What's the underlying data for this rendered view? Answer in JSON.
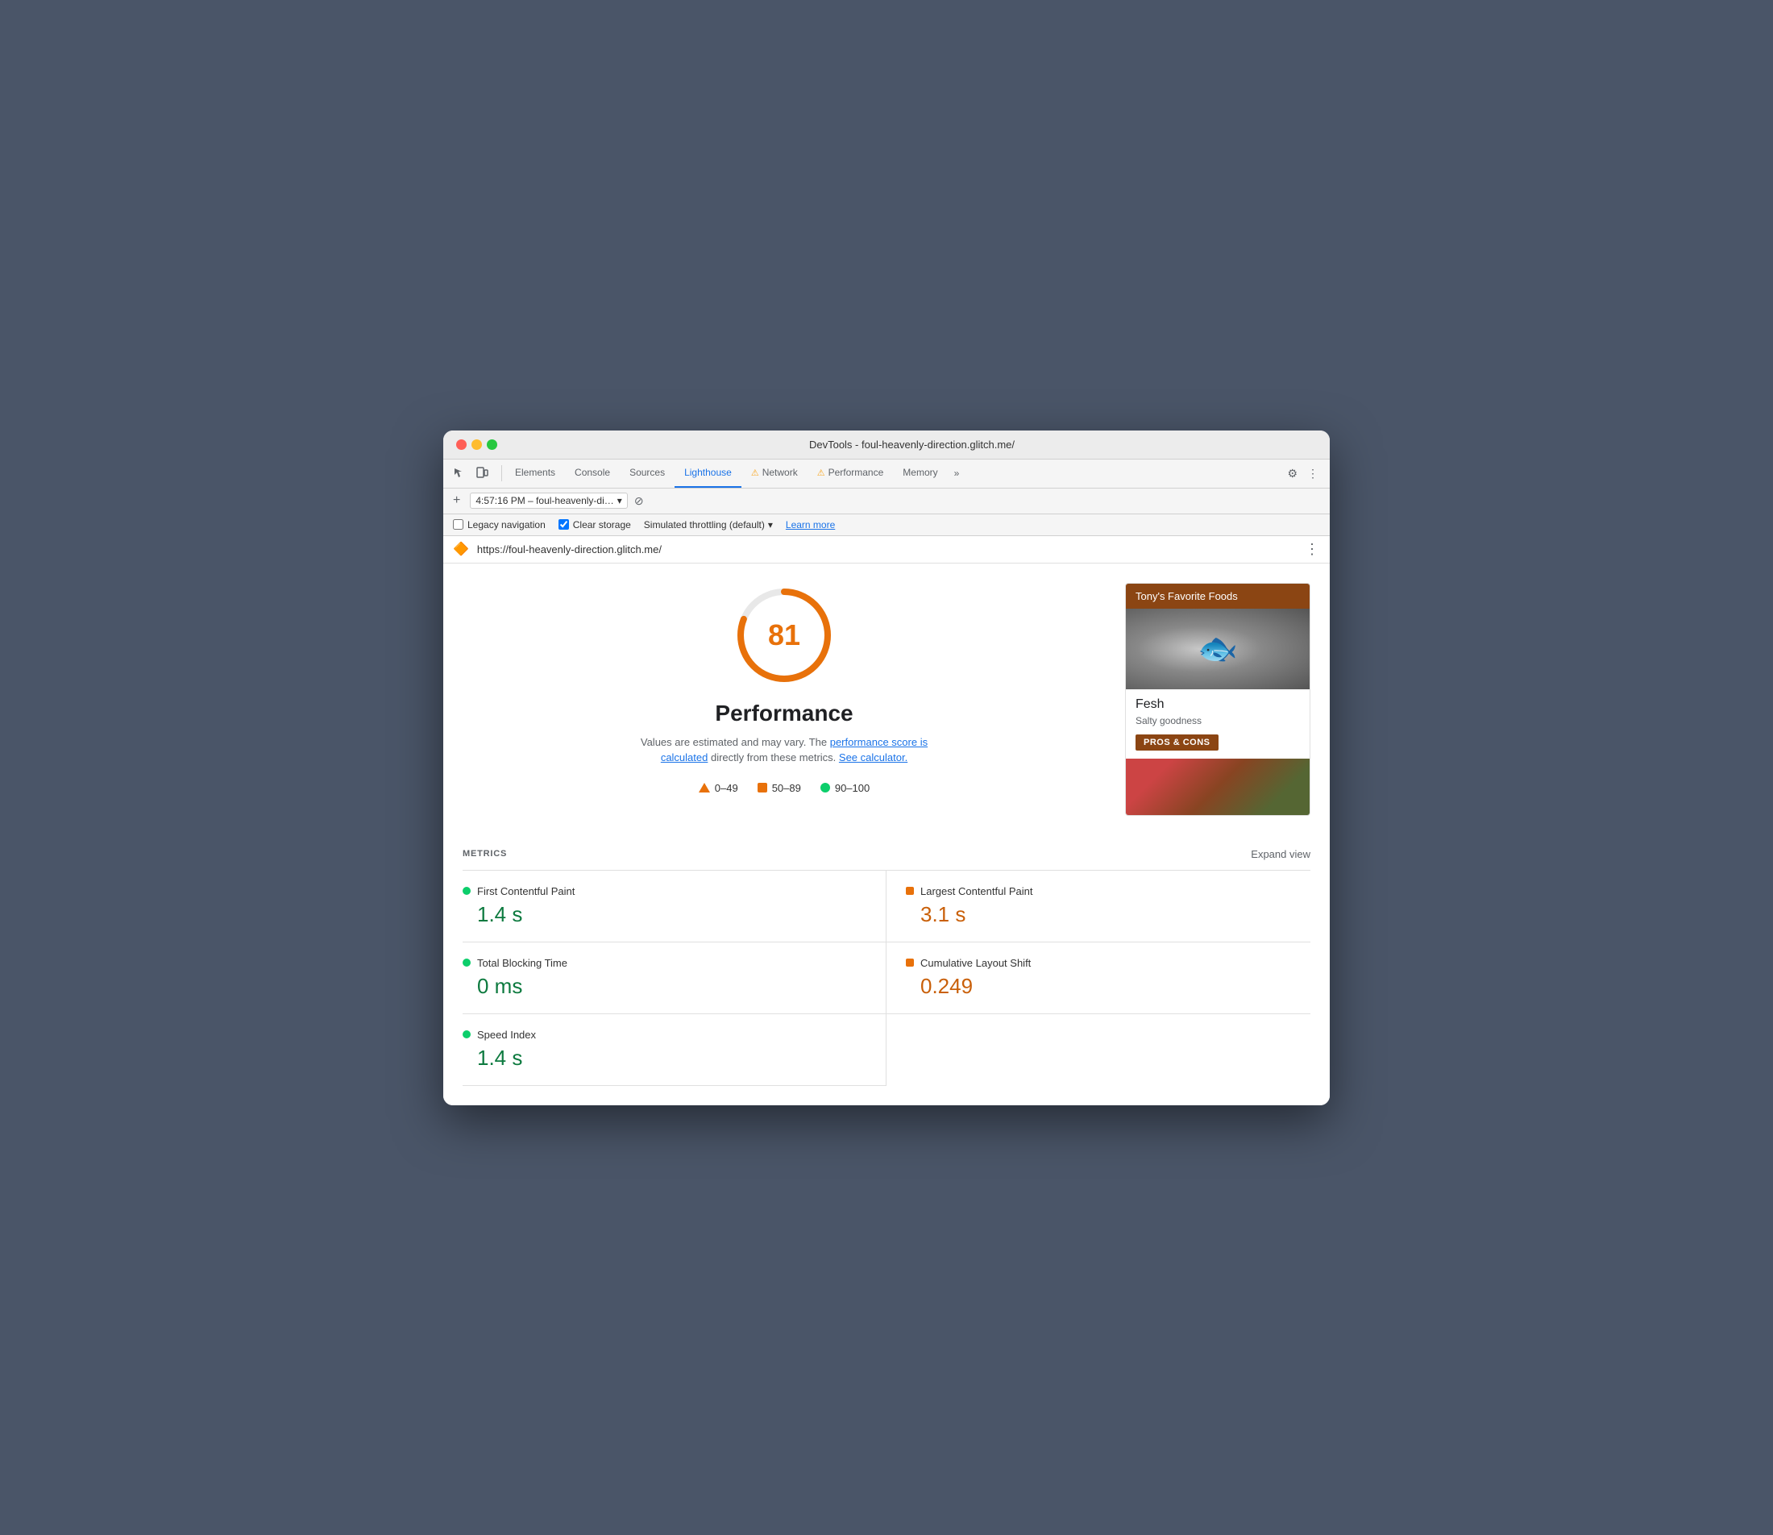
{
  "window": {
    "title": "DevTools - foul-heavenly-direction.glitch.me/"
  },
  "traffic_lights": {
    "red_label": "close",
    "yellow_label": "minimize",
    "green_label": "maximize"
  },
  "devtools": {
    "tabs": [
      {
        "id": "elements",
        "label": "Elements",
        "active": false,
        "warning": false
      },
      {
        "id": "console",
        "label": "Console",
        "active": false,
        "warning": false
      },
      {
        "id": "sources",
        "label": "Sources",
        "active": false,
        "warning": false
      },
      {
        "id": "lighthouse",
        "label": "Lighthouse",
        "active": true,
        "warning": false
      },
      {
        "id": "network",
        "label": "Network",
        "active": false,
        "warning": true
      },
      {
        "id": "performance",
        "label": "Performance",
        "active": false,
        "warning": true
      },
      {
        "id": "memory",
        "label": "Memory",
        "active": false,
        "warning": false
      }
    ],
    "more_tabs": "»"
  },
  "toolbar": {
    "add_icon": "+",
    "session_label": "4:57:16 PM – foul-heavenly-di…",
    "session_dropdown": "▾",
    "refresh_icon": "⊘"
  },
  "options": {
    "legacy_navigation_label": "Legacy navigation",
    "legacy_navigation_checked": false,
    "clear_storage_label": "Clear storage",
    "clear_storage_checked": true,
    "simulated_throttling_label": "Simulated throttling (default)",
    "throttle_dropdown": "▾",
    "learn_more_label": "Learn more"
  },
  "url_bar": {
    "url": "https://foul-heavenly-direction.glitch.me/",
    "favicon": "🔶"
  },
  "score": {
    "value": 81,
    "color": "#e8710a",
    "percentage": 81,
    "circumference": 339.3,
    "title": "Performance"
  },
  "description": {
    "text_before": "Values are estimated and may vary. The ",
    "link1_text": "performance score is calculated",
    "text_middle": " directly from these metrics. ",
    "link2_text": "See calculator."
  },
  "legend": {
    "items": [
      {
        "id": "range-bad",
        "shape": "triangle",
        "label": "0–49"
      },
      {
        "id": "range-ok",
        "shape": "square",
        "label": "50–89"
      },
      {
        "id": "range-good",
        "shape": "circle",
        "label": "90–100"
      }
    ]
  },
  "preview_card": {
    "header": "Tony's Favorite Foods",
    "item_name": "Fesh",
    "item_desc": "Salty goodness",
    "pros_cons_btn": "PROS & CONS"
  },
  "metrics": {
    "section_label": "METRICS",
    "expand_label": "Expand view",
    "items": [
      {
        "id": "fcp",
        "name": "First Contentful Paint",
        "value": "1.4 s",
        "status": "green",
        "shape": "circle"
      },
      {
        "id": "lcp",
        "name": "Largest Contentful Paint",
        "value": "3.1 s",
        "status": "orange",
        "shape": "square"
      },
      {
        "id": "tbt",
        "name": "Total Blocking Time",
        "value": "0 ms",
        "status": "green",
        "shape": "circle"
      },
      {
        "id": "cls",
        "name": "Cumulative Layout Shift",
        "value": "0.249",
        "status": "orange",
        "shape": "square"
      },
      {
        "id": "si",
        "name": "Speed Index",
        "value": "1.4 s",
        "status": "green",
        "shape": "circle"
      }
    ]
  }
}
